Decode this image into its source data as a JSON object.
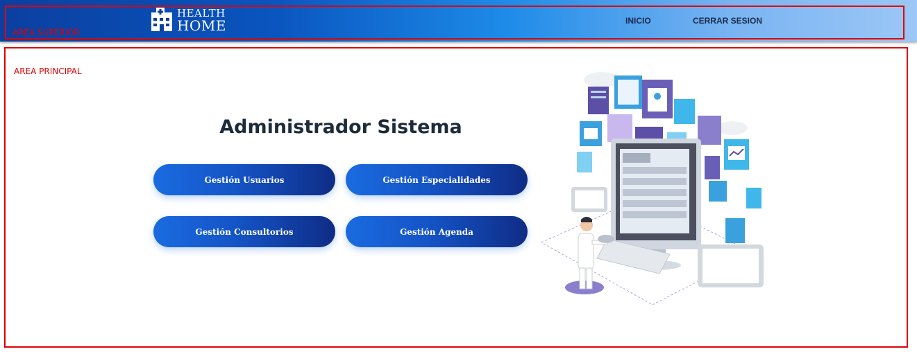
{
  "header": {
    "area_label": "AREA SUPERIOR",
    "logo": {
      "line1": "HEALTH",
      "line2": "HOME",
      "icon": "hospital-building-icon"
    },
    "nav": [
      {
        "label": "INICIO"
      },
      {
        "label": "CERRAR SESION"
      }
    ]
  },
  "main": {
    "area_label": "AREA PRINCIPAL",
    "title": "Administrador Sistema",
    "buttons": [
      {
        "label": "Gestión Usuarios"
      },
      {
        "label": "Gestión Especialidades"
      },
      {
        "label": "Gestión Consultorios"
      },
      {
        "label": "Gestión Agenda"
      }
    ],
    "illustration_icon": "doctor-computer-illustration"
  },
  "colors": {
    "outline": "#e00000",
    "button_start": "#1a6be0",
    "button_end": "#0f2c86",
    "header_start": "#0b3fa0",
    "header_end": "#9cc7f6"
  }
}
